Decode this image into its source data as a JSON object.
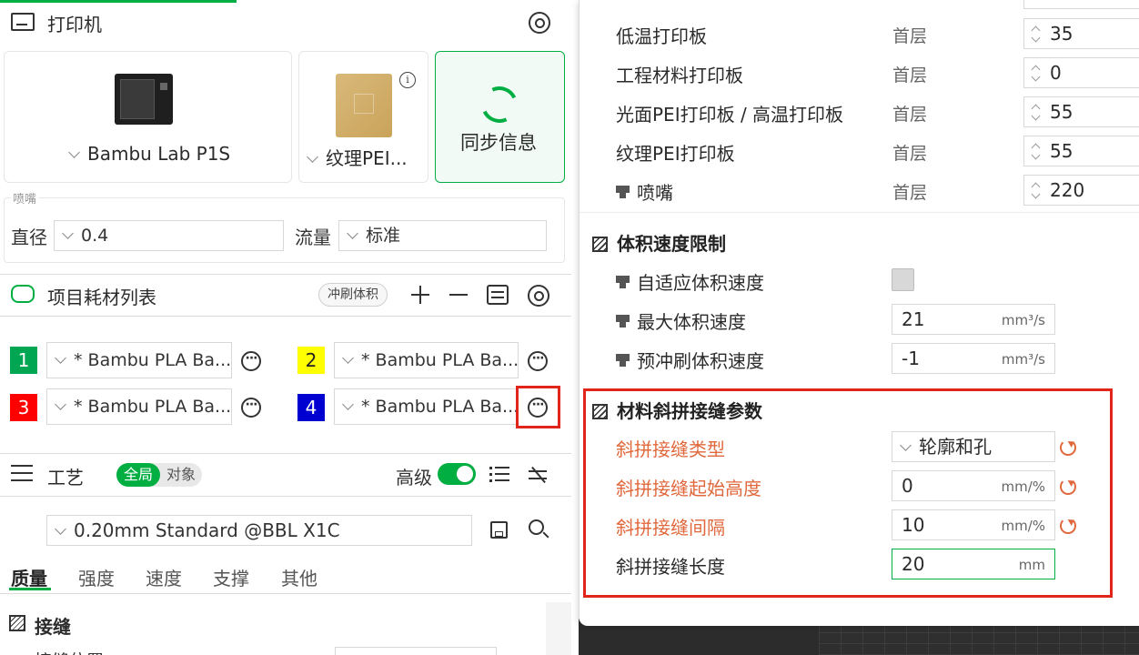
{
  "printer_section": {
    "title": "打印机",
    "printer_name": "Bambu Lab P1S",
    "plate_name": "纹理PEI...",
    "sync_label": "同步信息"
  },
  "nozzle_section": {
    "title": "喷嘴",
    "diameter_label": "直径",
    "diameter_value": "0.4",
    "flow_label": "流量",
    "flow_value": "标准"
  },
  "filament_section": {
    "title": "项目耗材列表",
    "flush_label": "冲刷体积",
    "slots": [
      {
        "num": "1",
        "name": "* Bambu PLA Ba...",
        "color": "#00a651",
        "text_color": "#ffffff"
      },
      {
        "num": "2",
        "name": "* Bambu PLA Ba...",
        "color": "#ffff00",
        "text_color": "#222222"
      },
      {
        "num": "3",
        "name": "* Bambu PLA Ba...",
        "color": "#ff0000",
        "text_color": "#ffffff"
      },
      {
        "num": "4",
        "name": "* Bambu PLA Ba...",
        "color": "#0000d0",
        "text_color": "#ffffff"
      }
    ]
  },
  "process_section": {
    "title": "工艺",
    "global_label": "全局",
    "object_label": "对象",
    "advanced_label": "高级",
    "preset": "0.20mm Standard @BBL X1C",
    "tabs": [
      "质量",
      "强度",
      "速度",
      "支撑",
      "其他"
    ],
    "seam_group": "接缝",
    "seam_partial": "接缝位置"
  },
  "right_panel": {
    "plate_temps": [
      {
        "label": "低温打印板",
        "sub": "首层",
        "value": "35",
        "icon": ""
      },
      {
        "label": "工程材料打印板",
        "sub": "首层",
        "value": "0",
        "icon": ""
      },
      {
        "label": "光面PEI打印板 / 高温打印板",
        "sub": "首层",
        "value": "55",
        "icon": ""
      },
      {
        "label": "纹理PEI打印板",
        "sub": "首层",
        "value": "55",
        "icon": ""
      },
      {
        "label": "喷嘴",
        "sub": "首层",
        "value": "220",
        "icon": "nozzle-icon"
      }
    ],
    "volumetric": {
      "title": "体积速度限制",
      "adaptive_label": "自适应体积速度",
      "max_label": "最大体积速度",
      "max_value": "21",
      "max_unit": "mm³/s",
      "preflush_label": "预冲刷体积速度",
      "preflush_value": "-1",
      "preflush_unit": "mm³/s"
    },
    "scarf": {
      "title": "材料斜拼接缝参数",
      "type_label": "斜拼接缝类型",
      "type_value": "轮廓和孔",
      "start_label": "斜拼接缝起始高度",
      "start_value": "0",
      "start_unit": "mm/%",
      "gap_label": "斜拼接缝间隔",
      "gap_value": "10",
      "gap_unit": "mm/%",
      "length_label": "斜拼接缝长度",
      "length_value": "20",
      "length_unit": "mm"
    }
  },
  "colors": {
    "accent": "#00ae42",
    "modified": "#e0683c",
    "highlight": "#e1251b"
  }
}
